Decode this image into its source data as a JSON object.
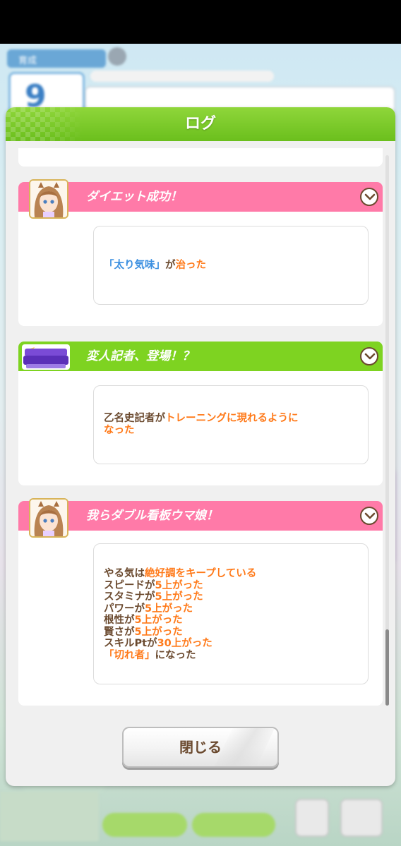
{
  "modal": {
    "title": "ログ",
    "close_label": "閉じる"
  },
  "entries": [
    {
      "title": "ダイエット成功！",
      "header_color": "#ff7aa8",
      "icon": "character-avatar-icon",
      "lines": [
        [
          {
            "text": "「太り気味」",
            "color": "blue"
          },
          {
            "text": "が",
            "color": "brown"
          },
          {
            "text": "治った",
            "color": "orange"
          }
        ]
      ]
    },
    {
      "title": "変人記者、登場！？",
      "header_color": "#7ed321",
      "icon": "beyond-dreams-logo",
      "lines": [
        [
          {
            "text": "乙名史記者が",
            "color": "brown"
          },
          {
            "text": "トレーニングに現れるように",
            "color": "orange"
          }
        ],
        [
          {
            "text": "なった",
            "color": "orange"
          }
        ]
      ]
    },
    {
      "title": "我らダブル看板ウマ娘！",
      "header_color": "#ff7aa8",
      "icon": "character-avatar-icon",
      "lines": [
        [
          {
            "text": "やる気は",
            "color": "brown"
          },
          {
            "text": "絶好調をキープしている",
            "color": "orange"
          }
        ],
        [
          {
            "text": "スピードが",
            "color": "brown"
          },
          {
            "text": "5上がった",
            "color": "orange"
          }
        ],
        [
          {
            "text": "スタミナが",
            "color": "brown"
          },
          {
            "text": "5上がった",
            "color": "orange"
          }
        ],
        [
          {
            "text": "パワーが",
            "color": "brown"
          },
          {
            "text": "5上がった",
            "color": "orange"
          }
        ],
        [
          {
            "text": "根性が",
            "color": "brown"
          },
          {
            "text": "5上がった",
            "color": "orange"
          }
        ],
        [
          {
            "text": "賢さが",
            "color": "brown"
          },
          {
            "text": "5上がった",
            "color": "orange"
          }
        ],
        [
          {
            "text": "スキルPtが",
            "color": "brown"
          },
          {
            "text": "30上がった",
            "color": "orange"
          }
        ],
        [
          {
            "text": "「切れ者」",
            "color": "orange"
          },
          {
            "text": "になった",
            "color": "brown"
          }
        ]
      ]
    }
  ],
  "background": {
    "turn_number": "9",
    "tag_label": "育成"
  }
}
